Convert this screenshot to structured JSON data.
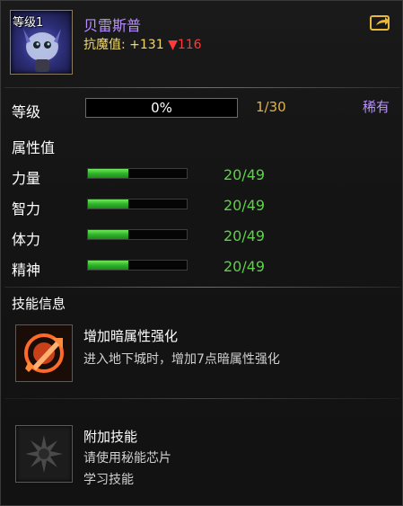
{
  "header": {
    "level_label": "等级1",
    "name": "贝雷斯普",
    "resist_label": "抗魔值: ",
    "resist_value": "+131",
    "resist_drop": "▼116"
  },
  "level_row": {
    "label": "等级",
    "progress_text": "0%",
    "progress": 0,
    "count": "1/30",
    "rarity": "稀有"
  },
  "attributes": {
    "title": "属性值",
    "stats": [
      {
        "label": "力量",
        "value": "20/49",
        "fill": 0.41
      },
      {
        "label": "智力",
        "value": "20/49",
        "fill": 0.41
      },
      {
        "label": "体力",
        "value": "20/49",
        "fill": 0.41
      },
      {
        "label": "精神",
        "value": "20/49",
        "fill": 0.41
      }
    ]
  },
  "skills": {
    "title": "技能信息",
    "items": [
      {
        "title": "增加暗属性强化",
        "desc1": "进入地下城时，增加7点暗属性强化",
        "desc2": ""
      },
      {
        "title": "附加技能",
        "desc1": "请使用秘能芯片",
        "desc2": "学习技能"
      }
    ]
  },
  "colors": {
    "name": "#b890ff",
    "resist": "#f0d96a",
    "drop": "#ff3a3a",
    "stat_value": "#5fd04a",
    "exp_count": "#e0b24a"
  },
  "icons": [
    "share-icon",
    "dark-enhance-skill-icon",
    "locked-skill-icon"
  ]
}
